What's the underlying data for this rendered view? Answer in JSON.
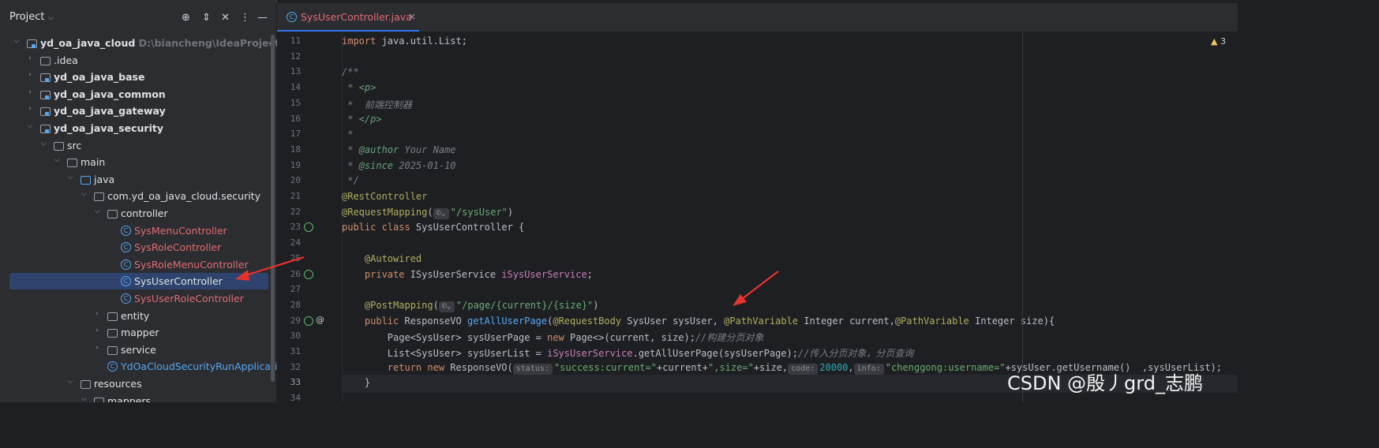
{
  "project_panel": {
    "title": "Project",
    "tree": [
      {
        "label": "yd_oa_java_cloud",
        "path": "D:\\biancheng\\IdeaProjects\\yd_oa_java",
        "indent": 0,
        "arrow": "down",
        "icon": "module",
        "style": "bold"
      },
      {
        "label": ".idea",
        "indent": 1,
        "arrow": "right",
        "icon": "folder",
        "style": "normal"
      },
      {
        "label": "yd_oa_java_base",
        "indent": 1,
        "arrow": "right",
        "icon": "module",
        "style": "bold"
      },
      {
        "label": "yd_oa_java_common",
        "indent": 1,
        "arrow": "right",
        "icon": "module",
        "style": "bold"
      },
      {
        "label": "yd_oa_java_gateway",
        "indent": 1,
        "arrow": "right",
        "icon": "module",
        "style": "bold"
      },
      {
        "label": "yd_oa_java_security",
        "indent": 1,
        "arrow": "down",
        "icon": "module",
        "style": "bold"
      },
      {
        "label": "src",
        "indent": 2,
        "arrow": "down",
        "icon": "folder",
        "style": "normal"
      },
      {
        "label": "main",
        "indent": 3,
        "arrow": "down",
        "icon": "folder",
        "style": "normal"
      },
      {
        "label": "java",
        "indent": 4,
        "arrow": "down",
        "icon": "java-folder",
        "style": "normal"
      },
      {
        "label": "com.yd_oa_java_cloud.security",
        "indent": 5,
        "arrow": "down",
        "icon": "package",
        "style": "normal"
      },
      {
        "label": "controller",
        "indent": 6,
        "arrow": "down",
        "icon": "package",
        "style": "normal"
      },
      {
        "label": "SysMenuController",
        "indent": 7,
        "arrow": "",
        "icon": "class",
        "style": "red"
      },
      {
        "label": "SysRoleController",
        "indent": 7,
        "arrow": "",
        "icon": "class",
        "style": "red"
      },
      {
        "label": "SysRoleMenuController",
        "indent": 7,
        "arrow": "",
        "icon": "class",
        "style": "red"
      },
      {
        "label": "SysUserController",
        "indent": 7,
        "arrow": "",
        "icon": "class",
        "style": "selected"
      },
      {
        "label": "SysUserRoleController",
        "indent": 7,
        "arrow": "",
        "icon": "class",
        "style": "red"
      },
      {
        "label": "entity",
        "indent": 6,
        "arrow": "right",
        "icon": "package",
        "style": "normal"
      },
      {
        "label": "mapper",
        "indent": 6,
        "arrow": "right",
        "icon": "package",
        "style": "normal"
      },
      {
        "label": "service",
        "indent": 6,
        "arrow": "right",
        "icon": "package",
        "style": "normal"
      },
      {
        "label": "YdOaCloudSecurityRunApplication",
        "indent": 6,
        "arrow": "",
        "icon": "class",
        "style": "blue"
      },
      {
        "label": "resources",
        "indent": 4,
        "arrow": "down",
        "icon": "resources",
        "style": "normal"
      },
      {
        "label": "mappers",
        "indent": 5,
        "arrow": "down",
        "icon": "folder",
        "style": "normal"
      }
    ]
  },
  "editor": {
    "tab_label": "SysUserController.java",
    "tab_icon": "class-icon",
    "warning_count": "3",
    "current_line": 33,
    "lines": [
      {
        "n": "11",
        "parts": [
          [
            "kw",
            "import"
          ],
          [
            "",
            ""
          ],
          [
            "plain",
            " java.util.List;"
          ]
        ]
      },
      {
        "n": "12",
        "parts": []
      },
      {
        "n": "13",
        "parts": [
          [
            "cmt",
            "/**"
          ]
        ]
      },
      {
        "n": "14",
        "parts": [
          [
            "cmt",
            " * "
          ],
          [
            "cmt-tag",
            "<p>"
          ]
        ]
      },
      {
        "n": "15",
        "parts": [
          [
            "cmt",
            " *  前端控制器"
          ]
        ]
      },
      {
        "n": "16",
        "parts": [
          [
            "cmt",
            " * "
          ],
          [
            "cmt-tag",
            "</p>"
          ]
        ]
      },
      {
        "n": "17",
        "parts": [
          [
            "cmt",
            " *"
          ]
        ]
      },
      {
        "n": "18",
        "parts": [
          [
            "cmt",
            " * "
          ],
          [
            "cmt-tag",
            "@author"
          ],
          [
            "cmt",
            " Your Name"
          ]
        ]
      },
      {
        "n": "19",
        "parts": [
          [
            "cmt",
            " * "
          ],
          [
            "cmt-tag",
            "@since"
          ],
          [
            "cmt",
            " 2025-01-10"
          ]
        ]
      },
      {
        "n": "20",
        "parts": [
          [
            "cmt",
            " */"
          ]
        ]
      },
      {
        "n": "21",
        "parts": [
          [
            "ann",
            "@RestController"
          ]
        ]
      },
      {
        "n": "22",
        "parts": [
          [
            "ann",
            "@RequestMapping"
          ],
          [
            "plain",
            "("
          ],
          [
            "hint",
            "©⌄"
          ],
          [
            "str",
            "\"/sysUser\""
          ],
          [
            "plain",
            ")"
          ]
        ]
      },
      {
        "n": "23",
        "parts": [
          [
            "kw",
            "public class "
          ],
          [
            "plain",
            "SysUserController {"
          ]
        ]
      },
      {
        "n": "24",
        "parts": []
      },
      {
        "n": "25",
        "parts": [
          [
            "plain",
            "    "
          ],
          [
            "ann",
            "@Autowired"
          ]
        ]
      },
      {
        "n": "26",
        "parts": [
          [
            "plain",
            "    "
          ],
          [
            "kw",
            "private "
          ],
          [
            "plain",
            "ISysUserService "
          ],
          [
            "fld",
            "iSysUserService"
          ],
          [
            "plain",
            ";"
          ]
        ]
      },
      {
        "n": "27",
        "parts": []
      },
      {
        "n": "28",
        "parts": [
          [
            "plain",
            "    "
          ],
          [
            "ann",
            "@PostMapping"
          ],
          [
            "plain",
            "("
          ],
          [
            "hint",
            "©⌄"
          ],
          [
            "str",
            "\"/page/{current}/{size}\""
          ],
          [
            "plain",
            ")"
          ]
        ]
      },
      {
        "n": "29",
        "parts": [
          [
            "plain",
            "    "
          ],
          [
            "kw",
            "public "
          ],
          [
            "plain",
            "ResponseVO "
          ],
          [
            "mth",
            "getAllUserPage"
          ],
          [
            "plain",
            "("
          ],
          [
            "ann",
            "@RequestBody "
          ],
          [
            "plain",
            "SysUser sysUser, "
          ],
          [
            "ann",
            "@PathVariable "
          ],
          [
            "plain",
            "Integer current,"
          ],
          [
            "ann",
            "@PathVariable "
          ],
          [
            "plain",
            "Integer size){"
          ]
        ]
      },
      {
        "n": "30",
        "parts": [
          [
            "plain",
            "        Page<SysUser> sysUserPage = "
          ],
          [
            "kw",
            "new "
          ],
          [
            "plain",
            "Page<>(current, size);"
          ],
          [
            "cmt",
            "//构建分页对象"
          ]
        ]
      },
      {
        "n": "31",
        "parts": [
          [
            "plain",
            "        List<SysUser> sysUserList = "
          ],
          [
            "fld",
            "iSysUserService"
          ],
          [
            "plain",
            ".getAllUserPage(sysUserPage);"
          ],
          [
            "cmt",
            "//传入分页对象，分页查询"
          ]
        ]
      },
      {
        "n": "32",
        "parts": [
          [
            "plain",
            "        "
          ],
          [
            "kw",
            "return new "
          ],
          [
            "plain",
            "ResponseVO("
          ],
          [
            "hint",
            "status:"
          ],
          [
            "str",
            "\"success:current=\""
          ],
          [
            "plain",
            "+current+"
          ],
          [
            "str",
            "\",size=\""
          ],
          [
            "plain",
            "+size,"
          ],
          [
            "hint",
            "code:"
          ],
          [
            "num",
            "20000"
          ],
          [
            "plain",
            ","
          ],
          [
            "hint",
            "info:"
          ],
          [
            "str",
            "\"chenggong:username=\""
          ],
          [
            "plain",
            "+sysUser.getUsername()  ,sysUserList);"
          ]
        ]
      },
      {
        "n": "33",
        "parts": [
          [
            "plain",
            "    }"
          ]
        ]
      },
      {
        "n": "34",
        "parts": []
      }
    ]
  },
  "watermark": "CSDN @殷丿grd_志鹏"
}
